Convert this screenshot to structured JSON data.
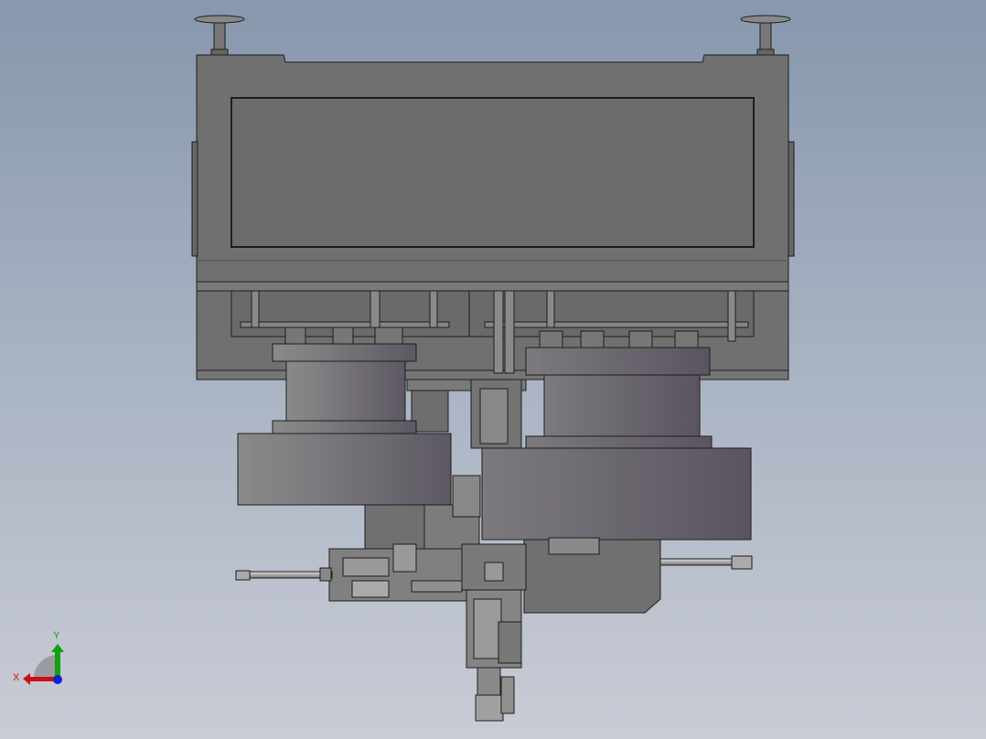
{
  "viewport": {
    "background_top": "#8797ad",
    "background_bottom": "#c9ccd5",
    "part_color": "#6f6f6f",
    "edge_color": "#1e1e1e"
  },
  "triad": {
    "x_label": "X",
    "y_label": "Y",
    "x_color": "#cc1010",
    "y_color": "#10a010",
    "z_color": "#1020d0"
  }
}
